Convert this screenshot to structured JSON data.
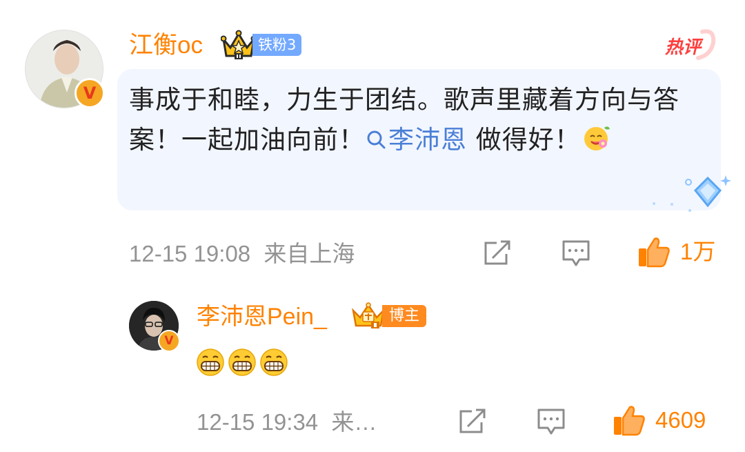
{
  "main_comment": {
    "username": "江衡oc",
    "fan_badge": "铁粉3",
    "hot_label": "热评",
    "text_before_mention": "事成于和睦，力生于团结。歌声里藏着方向与答案！一起加油向前！",
    "mention": "李沛恩",
    "text_after_mention": " 做得好！",
    "emoji": "flower-smile-emoji",
    "timestamp": "12-15 19:08",
    "location": "来自上海",
    "like_count": "1万"
  },
  "reply": {
    "username": "李沛恩Pein_",
    "role_badge": "博主",
    "emojis": [
      "grin-emoji",
      "grin-emoji",
      "grin-emoji"
    ],
    "timestamp": "12-15 19:34",
    "location": "来…",
    "like_count": "4609"
  },
  "colors": {
    "username": "#ff8200",
    "mention": "#4a7fd6",
    "meta": "#939393",
    "bubble": "#f2f6ff",
    "hot": "#ff3e3e",
    "fan_badge": "#73a9ff",
    "blogger_badge": "#ff8a1f"
  },
  "icons": {
    "share": "share-icon",
    "comment": "comment-icon",
    "like": "thumbs-up-icon",
    "verified": "verified-v-icon",
    "crown": "crown-icon",
    "search": "search-icon"
  }
}
